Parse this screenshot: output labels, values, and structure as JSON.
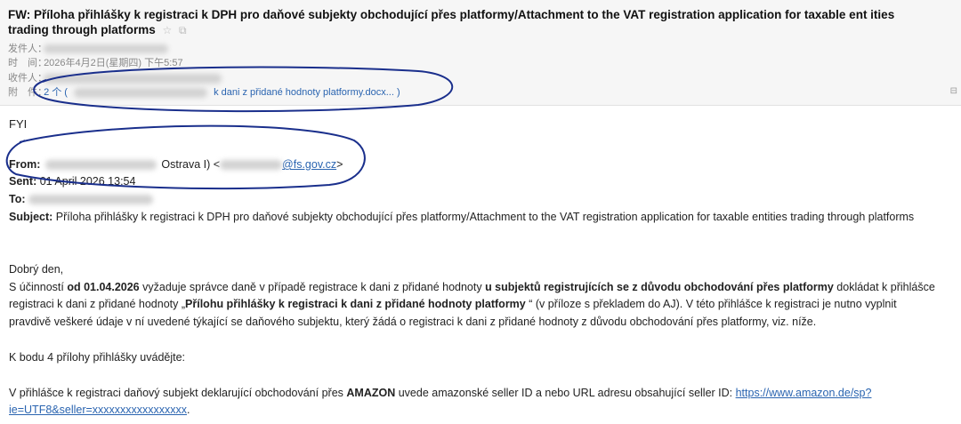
{
  "header": {
    "subject": "FW: Příloha přihlášky k registraci k DPH pro daňové subjekty obchodující přes platformy/Attachment to the VAT registration application for taxable ent ities trading through platforms",
    "sender_label": "发件人：",
    "time_label": "时　间：",
    "time_value": "2026年4月2日(星期四) 下午5:57",
    "recipient_label": "收件人：",
    "attachment_label": "附　件：",
    "attachment_count": "2 个 (",
    "attachment_name": "k dani z přidané hodnoty platformy.docx... )"
  },
  "email": {
    "greeting": "FYI",
    "from_label": "From:",
    "from_value": "Ostrava I) <",
    "from_email": "@fs.gov.cz",
    "from_end": ">",
    "sent_label": "Sent:",
    "sent_value": "01 April 2026 13:54",
    "to_label": "To:",
    "subject_label": "Subject:",
    "subject_value": "Příloha přihlášky k registraci k DPH pro daňové subjekty obchodující přes platformy/Attachment to the VAT registration application for taxable entities trading through platforms",
    "salutation": "Dobrý den,",
    "p1_a": "S účinností ",
    "p1_b": "od 01.04.2026",
    "p1_c": "  vyžaduje správce daně v případě registrace k dani z přidané hodnoty ",
    "p1_d": "u subjektů registrujících se z důvodu obchodování přes platformy",
    "p1_e": " dokládat k přihlášce",
    "p2_a": "registraci k dani z přidané hodnoty „",
    "p2_b": "Přílohu přihlášky k registraci k dani z přidané hodnoty  platformy",
    "p2_c": " “ (v příloze s překladem do AJ).   V této přihlášce k registraci je nutno vyplnit",
    "p3": "pravdivě veškeré údaje v ní uvedené týkající se daňového subjektu, který žádá o registraci k dani z přidané hodnoty z důvodu obchodování přes platformy, viz. níže.",
    "p4": "K bodu 4 přílohy přihlášky uvádějte:",
    "p5_a": "V přihlášce k registraci daňový subjekt  deklarující obchodování přes ",
    "p5_b": "AMAZON",
    "p5_c": " uvede    amazonské  seller ID a nebo URL adresu obsahující seller ID: ",
    "p5_link1": "https://www.amazon.de/sp?",
    "p6_link2": "ie=UTF8&seller=xxxxxxxxxxxxxxxxx",
    "p6_end": "."
  },
  "colors": {
    "link": "#2a64b0",
    "ink": "#1a2f8c",
    "header_bg": "#f6f6f6"
  }
}
